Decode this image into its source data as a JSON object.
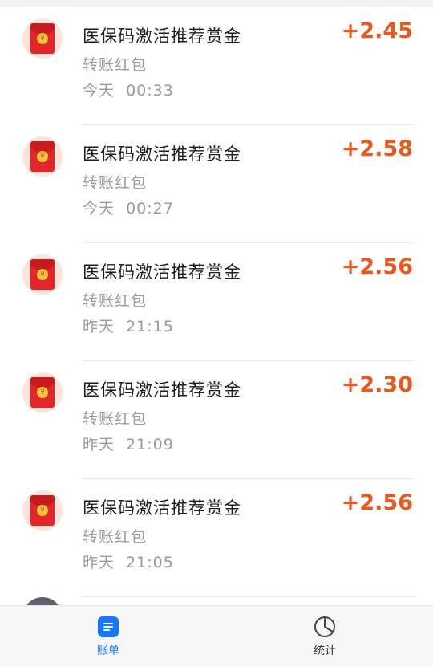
{
  "transactions": [
    {
      "title": "医保码激活推荐赏金",
      "type": "转账红包",
      "time": "今天  00:33",
      "amount": "+2.45"
    },
    {
      "title": "医保码激活推荐赏金",
      "type": "转账红包",
      "time": "今天  00:27",
      "amount": "+2.58"
    },
    {
      "title": "医保码激活推荐赏金",
      "type": "转账红包",
      "time": "昨天  21:15",
      "amount": "+2.56"
    },
    {
      "title": "医保码激活推荐赏金",
      "type": "转账红包",
      "time": "昨天  21:09",
      "amount": "+2.30"
    },
    {
      "title": "医保码激活推荐赏金",
      "type": "转账红包",
      "time": "昨天  21:05",
      "amount": "+2.56"
    }
  ],
  "tabs": {
    "bill_label": "账单",
    "stats_label": "统计"
  },
  "colors": {
    "amount": "#e8591d",
    "accent": "#1677ff",
    "envelope": "#e3262c"
  },
  "icons": {
    "row": "red-envelope-icon",
    "bill": "bill-list-icon",
    "stats": "pie-chart-icon"
  }
}
